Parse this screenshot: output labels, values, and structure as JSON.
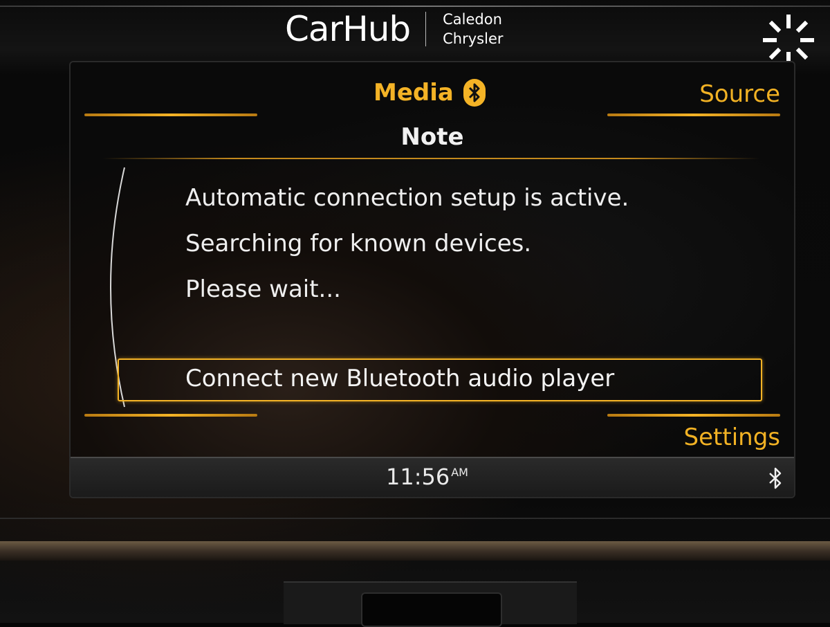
{
  "watermark": {
    "logo": "CarHub",
    "dealer_line1": "Caledon",
    "dealer_line2": "Chrysler"
  },
  "header": {
    "tab_media": "Media",
    "tab_source": "Source"
  },
  "dialog": {
    "title": "Note",
    "lines": [
      "Automatic connection setup is active.",
      "Searching for known devices.",
      "Please wait..."
    ],
    "option": "Connect new Bluetooth audio player"
  },
  "footer": {
    "tab_settings": "Settings"
  },
  "status_bar": {
    "time": "11:56",
    "ampm": "AM"
  },
  "icons": {
    "media_bluetooth": "bluetooth-icon",
    "status_bluetooth": "bluetooth-icon",
    "loading": "spinner-icon"
  },
  "colors": {
    "accent": "#f4b326",
    "text": "#efefef",
    "background": "#080808"
  }
}
